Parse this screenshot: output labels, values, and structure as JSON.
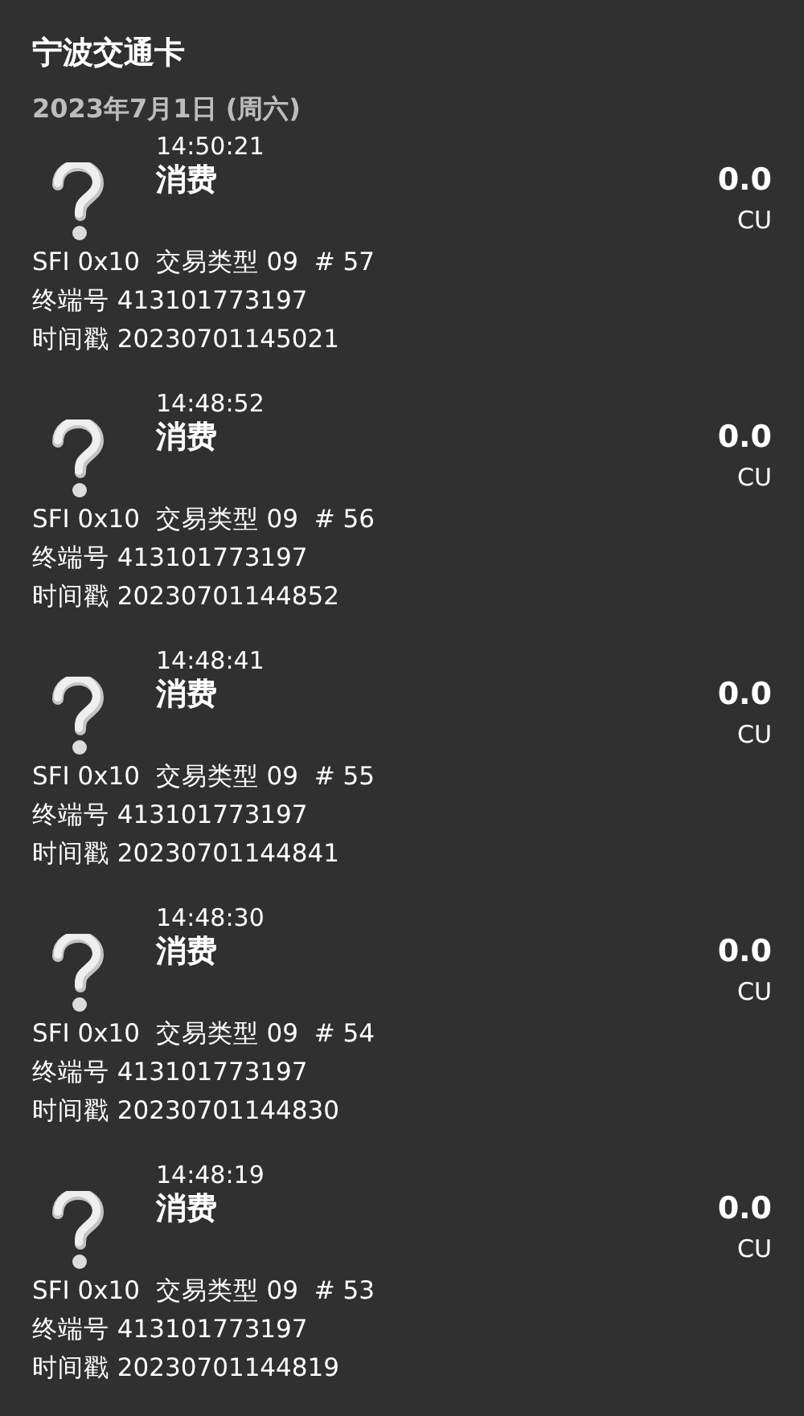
{
  "card_title": "宁波交通卡",
  "date": "2023年7月1日 (周六)",
  "transactions": [
    {
      "time": "14:50:21",
      "type": "消费",
      "amount": "0.0",
      "currency": "CU",
      "details": [
        "SFI 0x10  交易类型 09  # 57",
        "终端号 413101773197",
        "时间戳 20230701145021"
      ]
    },
    {
      "time": "14:48:52",
      "type": "消费",
      "amount": "0.0",
      "currency": "CU",
      "details": [
        "SFI 0x10  交易类型 09  # 56",
        "终端号 413101773197",
        "时间戳 20230701144852"
      ]
    },
    {
      "time": "14:48:41",
      "type": "消费",
      "amount": "0.0",
      "currency": "CU",
      "details": [
        "SFI 0x10  交易类型 09  # 55",
        "终端号 413101773197",
        "时间戳 20230701144841"
      ]
    },
    {
      "time": "14:48:30",
      "type": "消费",
      "amount": "0.0",
      "currency": "CU",
      "details": [
        "SFI 0x10  交易类型 09  # 54",
        "终端号 413101773197",
        "时间戳 20230701144830"
      ]
    },
    {
      "time": "14:48:19",
      "type": "消费",
      "amount": "0.0",
      "currency": "CU",
      "details": [
        "SFI 0x10  交易类型 09  # 53",
        "终端号 413101773197",
        "时间戳 20230701144819"
      ]
    }
  ]
}
